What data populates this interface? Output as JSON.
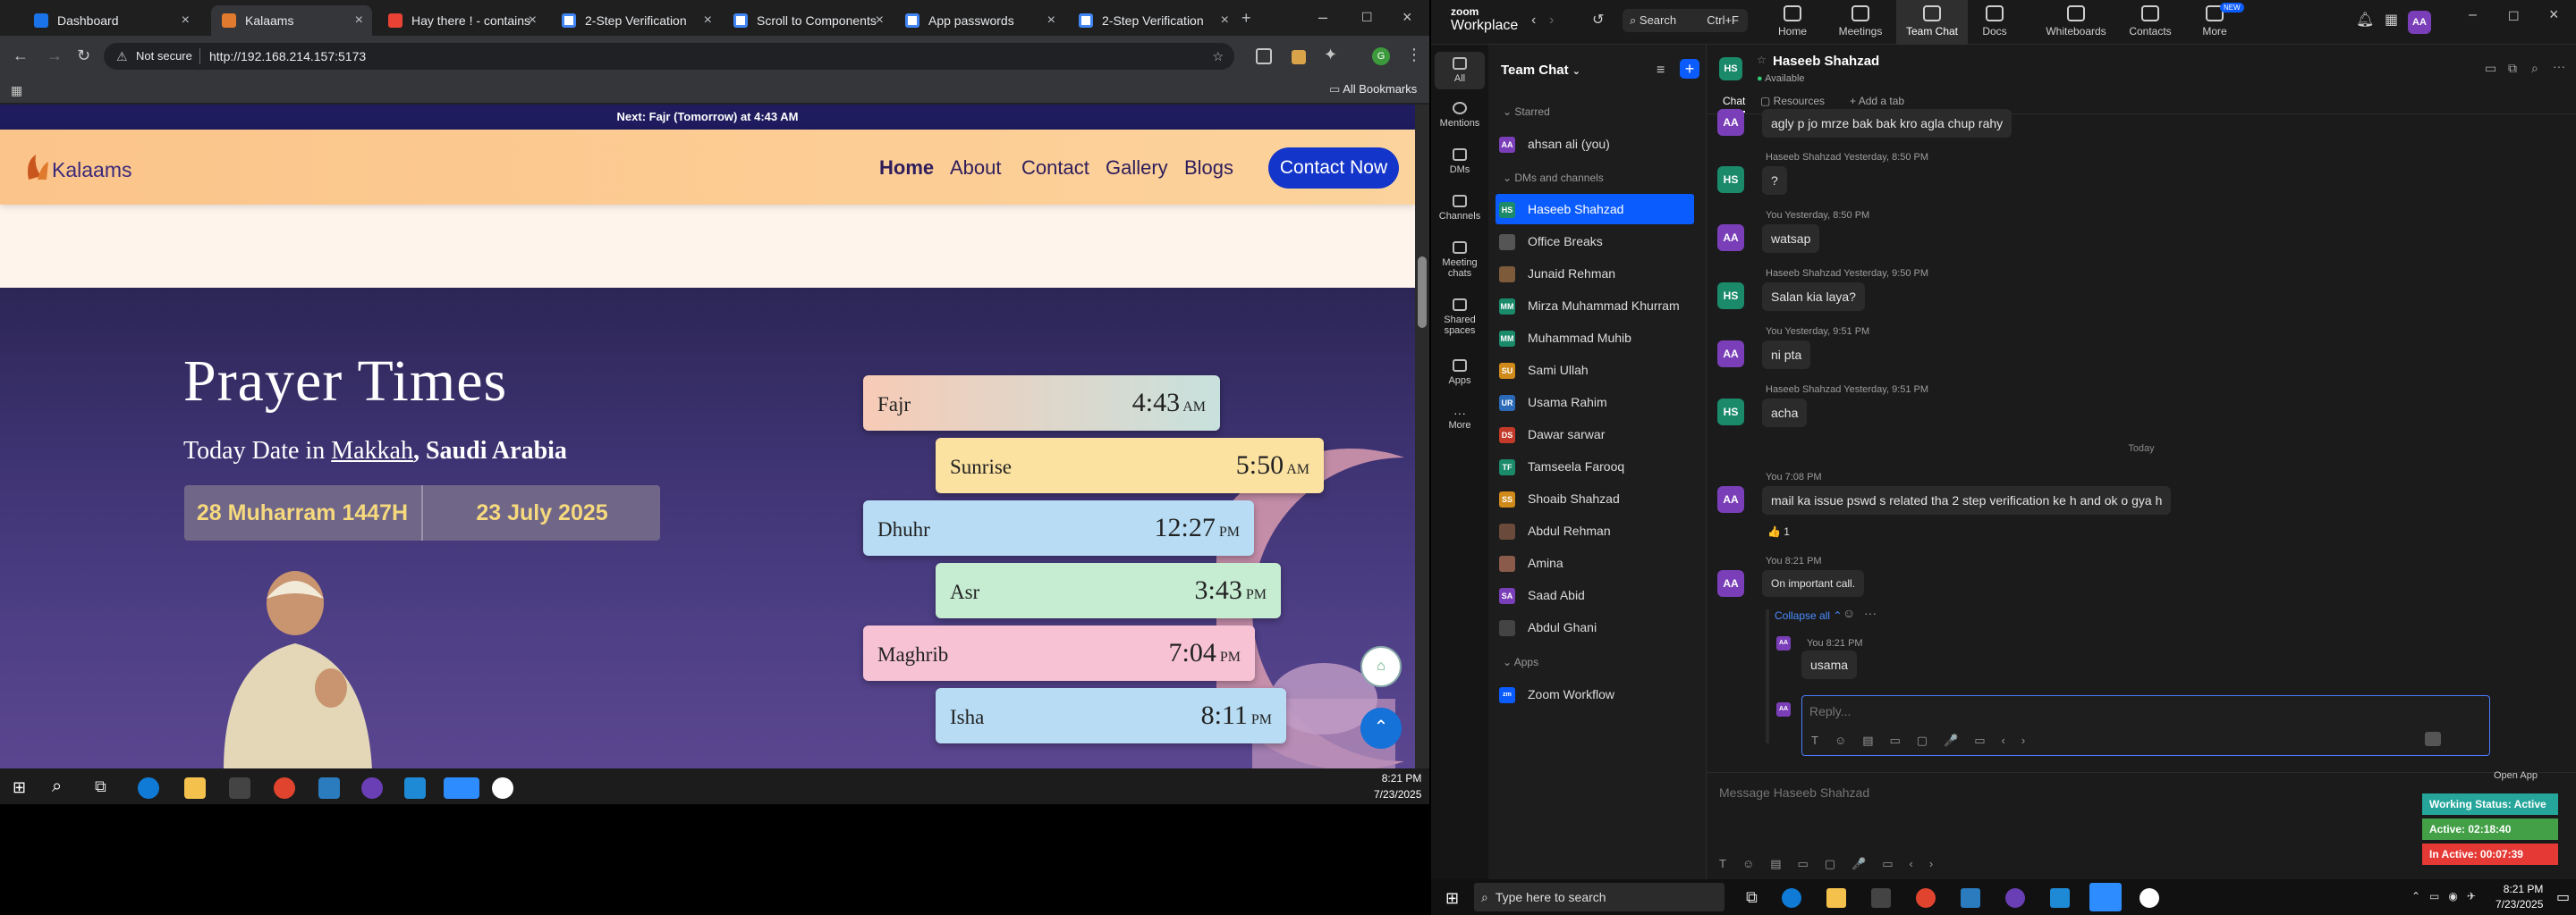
{
  "browser": {
    "tabs": [
      {
        "label": "Dashboard"
      },
      {
        "label": "Kalaams"
      },
      {
        "label": "Hay there ! - contains"
      },
      {
        "label": "2-Step Verification"
      },
      {
        "label": "Scroll to Components"
      },
      {
        "label": "App passwords"
      },
      {
        "label": "2-Step Verification"
      }
    ],
    "not_secure": "Not secure",
    "url": "http://192.168.214.157:5173",
    "all_bookmarks": "All Bookmarks"
  },
  "site": {
    "next_prayer": "Next: Fajr (Tomorrow) at 4:43 AM",
    "logo_text": "Kalaams",
    "nav": [
      "Home",
      "About",
      "Contact",
      "Gallery",
      "Blogs"
    ],
    "contact_button": "Contact Now",
    "hero_title": "Prayer Times",
    "hero_sub_prefix": "Today Date in ",
    "hero_city": "Makkah",
    "hero_country": ", Saudi Arabia",
    "hijri_date": "28 Muharram 1447H",
    "gregorian_date": "23 July 2025",
    "prayers": [
      {
        "name": "Fajr",
        "time": "4:43",
        "ampm": "AM"
      },
      {
        "name": "Sunrise",
        "time": "5:50",
        "ampm": "AM"
      },
      {
        "name": "Dhuhr",
        "time": "12:27",
        "ampm": "PM"
      },
      {
        "name": "Asr",
        "time": "3:43",
        "ampm": "PM"
      },
      {
        "name": "Maghrib",
        "time": "7:04",
        "ampm": "PM"
      },
      {
        "name": "Isha",
        "time": "8:11",
        "ampm": "PM"
      }
    ]
  },
  "taskbar_left": {
    "time": "8:21 PM",
    "date": "7/23/2025"
  },
  "zoom": {
    "brand_top": "zoom",
    "brand_bottom": "Workplace",
    "search": "Search",
    "search_shortcut": "Ctrl+F",
    "top_tabs": [
      "Home",
      "Meetings",
      "Team Chat",
      "Docs",
      "Whiteboards",
      "Contacts",
      "More"
    ],
    "new_badge": "NEW",
    "rail": [
      "All",
      "Mentions",
      "DMs",
      "Channels",
      "Meeting chats",
      "Shared spaces",
      "Apps",
      "More"
    ],
    "list_title": "Team Chat",
    "sections": {
      "starred": "Starred",
      "dms": "DMs and channels",
      "apps": "Apps"
    },
    "starred": [
      {
        "initials": "AA",
        "name": "ahsan ali (you)"
      }
    ],
    "contacts": [
      {
        "initials": "HS",
        "name": "Haseeb Shahzad"
      },
      {
        "initials": "",
        "name": "Office Breaks"
      },
      {
        "initials": "",
        "name": "Junaid Rehman"
      },
      {
        "initials": "MM",
        "name": "Mirza Muhammad Khurram"
      },
      {
        "initials": "MM",
        "name": "Muhammad Muhib"
      },
      {
        "initials": "SU",
        "name": "Sami Ullah"
      },
      {
        "initials": "UR",
        "name": "Usama Rahim"
      },
      {
        "initials": "DS",
        "name": "Dawar sarwar"
      },
      {
        "initials": "TF",
        "name": "Tamseela Farooq"
      },
      {
        "initials": "SS",
        "name": "Shoaib Shahzad"
      },
      {
        "initials": "",
        "name": "Abdul Rehman"
      },
      {
        "initials": "",
        "name": "Amina"
      },
      {
        "initials": "SA",
        "name": "Saad Abid"
      },
      {
        "initials": "",
        "name": "Abdul Ghani"
      }
    ],
    "apps": [
      {
        "name": "Zoom Workflow"
      }
    ],
    "chat_header": {
      "initials": "HS",
      "name": "Haseeb Shahzad",
      "status": "Available"
    },
    "chat_tabs": [
      "Chat",
      "Resources",
      "Add a tab"
    ],
    "messages": [
      {
        "who": "AA",
        "meta": "",
        "text": "agly p jo mrze bak bak kro agla chup rahy"
      },
      {
        "who": "HS",
        "meta": "Haseeb Shahzad Yesterday, 8:50 PM",
        "text": "?"
      },
      {
        "who": "AA",
        "meta": "You Yesterday, 8:50 PM",
        "text": "watsap"
      },
      {
        "who": "HS",
        "meta": "Haseeb Shahzad Yesterday, 9:50 PM",
        "text": "Salan kia laya?"
      },
      {
        "who": "AA",
        "meta": "You Yesterday, 9:51 PM",
        "text": "ni pta"
      },
      {
        "who": "HS",
        "meta": "Haseeb Shahzad Yesterday, 9:51 PM",
        "text": "acha"
      },
      {
        "who": "AA",
        "meta": "You 7:08 PM",
        "text": "mail ka issue pswd s related tha 2 step verification ke h and ok o gya h"
      },
      {
        "who": "AA",
        "meta": "You 8:21 PM",
        "text": "On important call."
      }
    ],
    "today_label": "Today",
    "reaction": "👍 1",
    "collapse_all": "Collapse all",
    "thread_reply": {
      "meta": "You 8:21 PM",
      "text": "usama"
    },
    "reply_placeholder": "Reply...",
    "message_placeholder": "Message Haseeb Shahzad",
    "open_app": "Open App",
    "working_status": "Working Status: Active",
    "active": "Active: 02:18:40",
    "inactive": "In Active: 00:07:39",
    "taskbar_search": "Type here to search",
    "time": "8:21 PM",
    "date": "7/23/2025"
  },
  "colors": {
    "accent": "#0b5cff",
    "site_nav": "#fbc48a",
    "contact_btn": "#1435c9",
    "hero_bg": "#3e3372"
  }
}
